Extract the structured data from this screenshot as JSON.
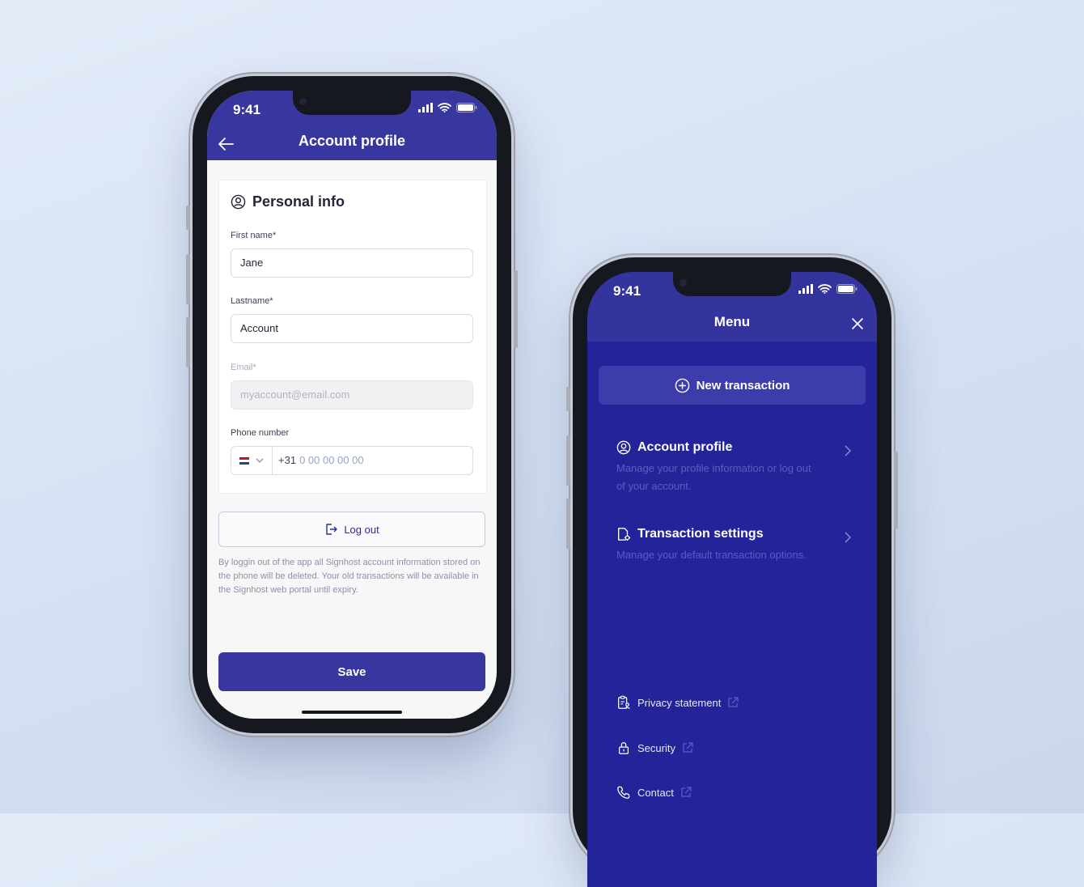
{
  "colors": {
    "brand": "#37379f",
    "menu_bg": "#24249a",
    "muted_text": "#5b5cc2"
  },
  "left_phone": {
    "status": {
      "time": "9:41"
    },
    "header": {
      "title": "Account profile",
      "back_icon": "arrow-left-icon"
    },
    "personal_info": {
      "heading": "Personal info",
      "first_name": {
        "label": "First name*",
        "value": "Jane"
      },
      "last_name": {
        "label": "Lastname*",
        "value": "Account"
      },
      "email": {
        "label": "Email*",
        "placeholder": "myaccount@email.com"
      },
      "phone": {
        "label": "Phone number",
        "prefix": "+31",
        "placeholder": "0 00 00 00 00"
      }
    },
    "logout_label": "Log out",
    "logout_note": "By loggin out of the app all Signhost account information stored on the phone will be deleted. Your old transactions will be available in the Signhost web portal until expiry.",
    "save_label": "Save"
  },
  "right_phone": {
    "status": {
      "time": "9:41"
    },
    "header": {
      "title": "Menu"
    },
    "new_transaction_label": "New transaction",
    "items": [
      {
        "title": "Account profile",
        "description": "Manage your profile information or log out of your account."
      },
      {
        "title": "Transaction settings",
        "description": "Manage your default transaction options."
      }
    ],
    "links": [
      {
        "label": "Privacy statement"
      },
      {
        "label": "Security"
      },
      {
        "label": "Contact"
      }
    ]
  }
}
